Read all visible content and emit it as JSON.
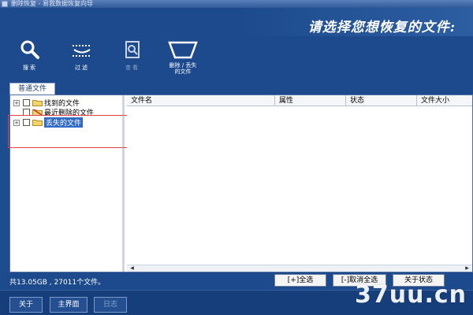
{
  "window": {
    "title": "删除恢复 - 易我数据恢复向导"
  },
  "header": {
    "prompt": "请选择您想恢复的文件:"
  },
  "toolbar": {
    "search": {
      "label": "搜索",
      "icon": "search-icon"
    },
    "filter": {
      "label": "过滤",
      "icon": "filter-icon"
    },
    "view": {
      "label": "查看",
      "icon": "view-icon"
    },
    "delete_lost": {
      "label_line1": "删除 / 丢失",
      "label_line2": "的文件",
      "icon": "delete-lost-icon"
    }
  },
  "tabs": [
    {
      "label": "普通文件",
      "active": true
    }
  ],
  "tree": {
    "items": [
      {
        "label": "找到的文件",
        "expandable": true,
        "checked": false,
        "icon": "folder-icon"
      },
      {
        "label": "最近删除的文件",
        "expandable": false,
        "checked": false,
        "icon": "folder-deleted-icon"
      },
      {
        "label": "丢失的文件",
        "expandable": true,
        "checked": false,
        "icon": "folder-icon",
        "selected": true
      }
    ]
  },
  "file_list": {
    "columns": [
      "文件名",
      "属性",
      "状态",
      "文件大小"
    ],
    "rows": []
  },
  "status": {
    "summary": "共13.05GB ,  27011个文件。"
  },
  "actions": {
    "select_all": "[+]全选",
    "deselect_all": "[-]取消全选",
    "about_status": "关于状态"
  },
  "nav": {
    "about": "关于",
    "main": "主界面",
    "log": "日志"
  },
  "watermark": {
    "text": "37uu.cn"
  },
  "colors": {
    "background": "#1c4a8c",
    "selection": "#3169c6",
    "highlight_box": "#e0414b"
  }
}
